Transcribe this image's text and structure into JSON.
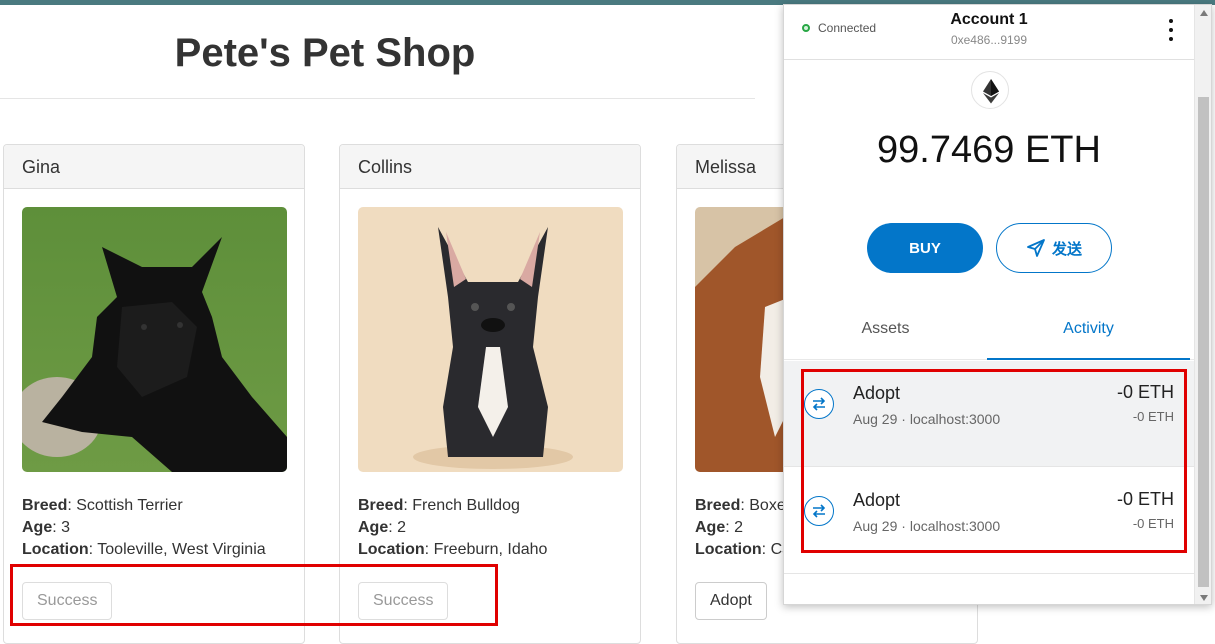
{
  "shop": {
    "title": "Pete's Pet Shop",
    "pets": [
      {
        "name": "Gina",
        "breed_label": "Breed",
        "breed": ": Scottish Terrier",
        "age_label": "Age",
        "age": ": 3",
        "location_label": "Location",
        "location": ": Tooleville, West Virginia",
        "button": "Success",
        "button_disabled": true
      },
      {
        "name": "Collins",
        "breed_label": "Breed",
        "breed": ": French Bulldog",
        "age_label": "Age",
        "age": ": 2",
        "location_label": "Location",
        "location": ": Freeburn, Idaho",
        "button": "Success",
        "button_disabled": true
      },
      {
        "name": "Melissa",
        "breed_label": "Breed",
        "breed": ": Boxe",
        "age_label": "Age",
        "age": ": 2",
        "location_label": "Location",
        "location": ": Ca",
        "button": "Adopt",
        "button_disabled": false
      }
    ]
  },
  "wallet": {
    "status": "Connected",
    "account_name": "Account 1",
    "account_address": "0xe486...9199",
    "balance": "99.7469 ETH",
    "buy_label": "BUY",
    "send_label": "发送",
    "tabs": [
      {
        "label": "Assets"
      },
      {
        "label": "Activity"
      }
    ],
    "active_tab": "Activity",
    "transactions": [
      {
        "title": "Adopt",
        "date": "Aug 29",
        "origin": "localhost:3000",
        "amount": "-0 ETH",
        "amount_secondary": "-0 ETH"
      },
      {
        "title": "Adopt",
        "date": "Aug 29",
        "origin": "localhost:3000",
        "amount": "-0 ETH",
        "amount_secondary": "-0 ETH"
      }
    ]
  },
  "colors": {
    "accent": "#0376c9",
    "highlight": "#e00000",
    "connected": "#28a745"
  }
}
